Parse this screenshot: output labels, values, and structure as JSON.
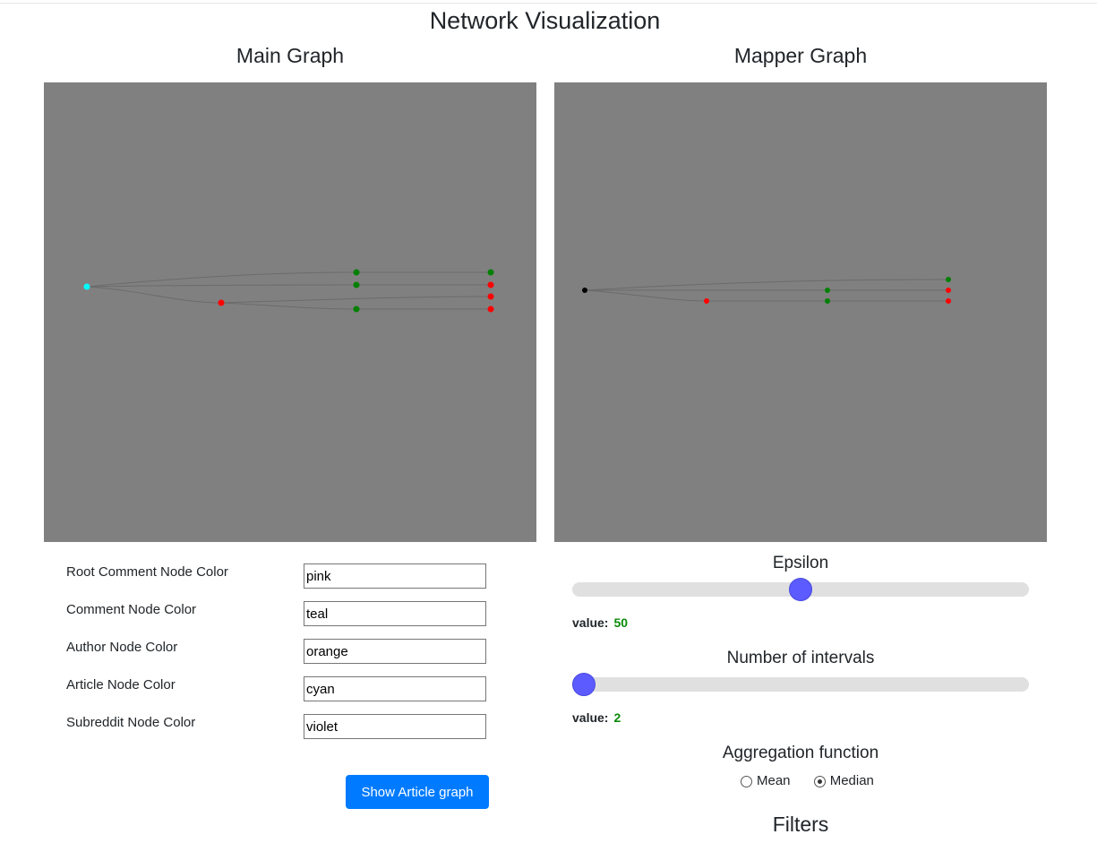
{
  "page_title": "Network Visualization",
  "main_graph": {
    "title": "Main Graph",
    "background": "#808080",
    "node_colors": {
      "root": "#00ffff",
      "green": "#008000",
      "red": "#ff0000"
    }
  },
  "mapper_graph": {
    "title": "Mapper Graph",
    "background": "#808080",
    "node_colors": {
      "root": "#000000",
      "green": "#008000",
      "red": "#ff0000"
    }
  },
  "color_form": {
    "fields": [
      {
        "label": "Root Comment Node Color",
        "value": "pink"
      },
      {
        "label": "Comment Node Color",
        "value": "teal"
      },
      {
        "label": "Author Node Color",
        "value": "orange"
      },
      {
        "label": "Article Node Color",
        "value": "cyan"
      },
      {
        "label": "Subreddit Node Color",
        "value": "violet"
      }
    ],
    "button_label": "Show Article graph"
  },
  "epsilon": {
    "label": "Epsilon",
    "value_label": "value:",
    "value": "50",
    "fraction": 0.5
  },
  "intervals": {
    "label": "Number of intervals",
    "value_label": "value:",
    "value": "2",
    "fraction": 0.0
  },
  "aggregation": {
    "label": "Aggregation function",
    "options": [
      {
        "label": "Mean",
        "checked": false
      },
      {
        "label": "Median",
        "checked": true
      }
    ]
  },
  "filters_title": "Filters",
  "colors": {
    "accent": "#007bff",
    "slider_thumb": "#5b5bff",
    "value_green": "#0a8a0a"
  }
}
